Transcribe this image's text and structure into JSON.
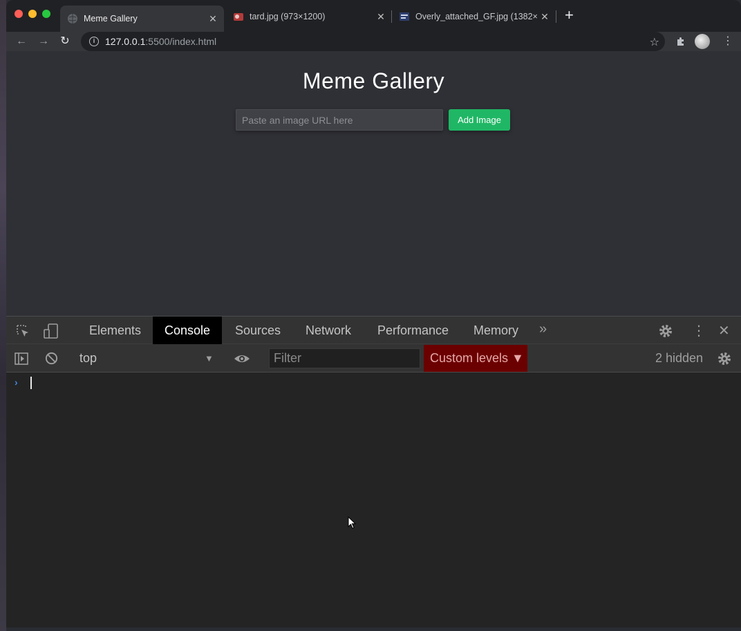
{
  "browser": {
    "tabs": [
      {
        "title": "Meme Gallery",
        "active": true
      },
      {
        "title": "tard.jpg (973×1200)",
        "active": false
      },
      {
        "title": "Overly_attached_GF.jpg (1382×",
        "active": false
      }
    ],
    "address": {
      "host": "127.0.0.1",
      "rest": ":5500/index.html"
    }
  },
  "page": {
    "title": "Meme Gallery",
    "input_placeholder": "Paste an image URL here",
    "add_button_label": "Add Image"
  },
  "devtools": {
    "tabs": [
      "Elements",
      "Console",
      "Sources",
      "Network",
      "Performance",
      "Memory"
    ],
    "active_tab": "Console",
    "context": "top",
    "filter_placeholder": "Filter",
    "levels_label": "Custom levels ▼",
    "hidden_count": "2 hidden",
    "prompt_symbol": "›"
  },
  "colors": {
    "accent_green": "#1fb765",
    "levels_bg": "#6b0000",
    "page_bg": "#2f3035"
  }
}
